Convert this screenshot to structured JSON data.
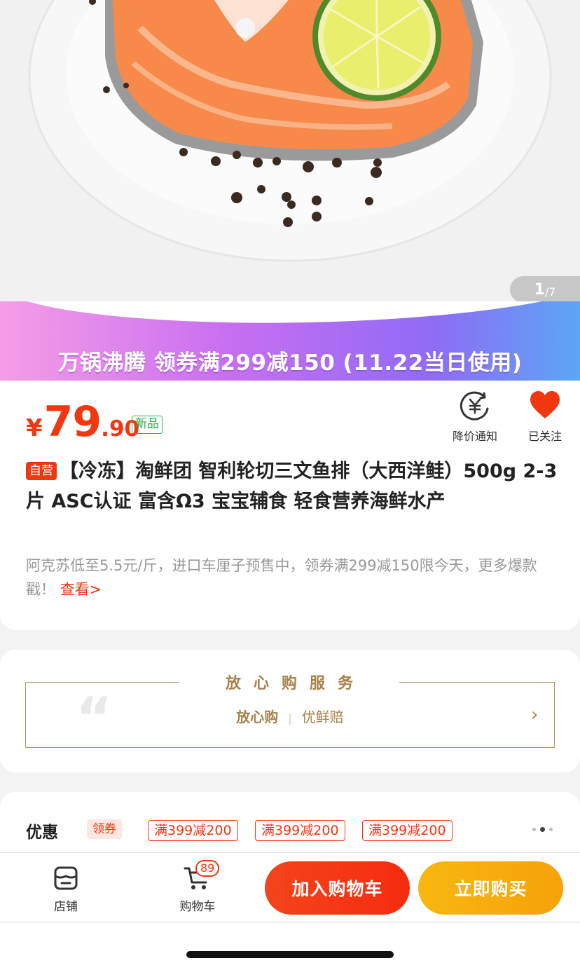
{
  "gallery": {
    "current": "1",
    "total": "/7"
  },
  "banner": {
    "text": "万锅沸腾 领券满299减150 (11.22当日使用)"
  },
  "price": {
    "currency": "¥",
    "integer": "79",
    "decimal": ".90",
    "tag": "新品"
  },
  "actions": {
    "notify_label": "降价通知",
    "follow_label": "已关注"
  },
  "product": {
    "self_tag": "自营",
    "title": "【冷冻】淘鲜团 智利轮切三文鱼排（大西洋鲑）500g 2-3片 ASC认证 富含Ω3 宝宝辅食 轻食营养海鲜水产",
    "desc": "阿克苏低至5.5元/斤，进口车厘子预售中，领券满299减150限今天，更多爆款戳！",
    "desc_link": "查看>"
  },
  "service": {
    "title": "放心购服务",
    "items": [
      "放心购",
      "优鲜赔"
    ],
    "arrow": "›"
  },
  "coupon": {
    "label": "优惠",
    "get_label": "领券",
    "chips": [
      "满399减200",
      "满399减200",
      "满399减200"
    ]
  },
  "bottom_bar": {
    "shop_label": "店铺",
    "cart_label": "购物车",
    "cart_count": "89",
    "add_cart_label": "加入购物车",
    "buy_now_label": "立即购买"
  },
  "colors": {
    "accent": "#f2370f",
    "buy": "#f7ab0c",
    "gold": "#a7824c",
    "new_green": "#2bb34a"
  }
}
